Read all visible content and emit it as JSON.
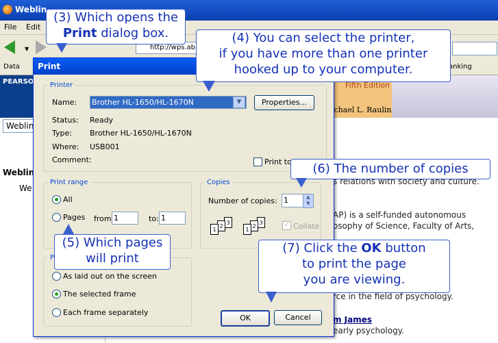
{
  "browser": {
    "title": "Weblin",
    "menu": [
      "File",
      "Edit"
    ],
    "url": "http://wps.ab",
    "bookmarks_left": "Data",
    "bookmarks_right": "anking"
  },
  "page": {
    "publisher": "PEARSO",
    "edition": "Fifth Edition",
    "author": "ichael L. Raulin",
    "tab": "Weblin",
    "heading": "Weblin",
    "intro": "We",
    "text_lines": [
      "s relations with society and culture.",
      "AP) is a self-funded autonomous",
      "osophy of Science, Faculty of Arts,",
      "rce in the field of psychology."
    ],
    "link": "m James",
    "link_after": "early psychology."
  },
  "dialog": {
    "title": "Print",
    "printer_group": "Printer",
    "name_label": "Name:",
    "printer_name": "Brother HL-1650/HL-1670N",
    "properties_button": "Properties...",
    "status_label": "Status:",
    "status_value": "Ready",
    "type_label": "Type:",
    "type_value": "Brother HL-1650/HL-1670N",
    "where_label": "Where:",
    "where_value": "USB001",
    "comment_label": "Comment:",
    "print_to_file": "Print to f",
    "print_range_group": "Print range",
    "all_label": "All",
    "pages_label": "Pages",
    "from_label": "from:",
    "from_value": "1",
    "to_label": "to:",
    "to_value": "1",
    "copies_group": "Copies",
    "copies_label": "Number of copies:",
    "copies_value": "1",
    "collate_label": "Collate",
    "frames_group": "P",
    "frame_options": [
      "As laid out on the screen",
      "The selected frame",
      "Each frame separately"
    ],
    "selected_frame_option": "The selected frame",
    "ok_button": "OK",
    "cancel_button": "Cancel"
  },
  "callouts": {
    "c3_line1": "(3) Which opens the",
    "c3_bold": "Print",
    "c3_rest": " dialog box.",
    "c4_line1": "(4) You can select the printer,",
    "c4_line2": "if you have more than one printer",
    "c4_line3": "hooked up to your computer.",
    "c5_line1": "(5) Which pages",
    "c5_line2": "will print",
    "c6": "(6) The number of copies",
    "c7_pre": "(7) Click the ",
    "c7_bold": "OK",
    "c7_post": " button",
    "c7_line2": "to print the page",
    "c7_line3": "you are viewing."
  },
  "colors": {
    "callout_text": "#1531b4",
    "titlebar": "#0a5ef5",
    "selection": "#316ac5"
  }
}
